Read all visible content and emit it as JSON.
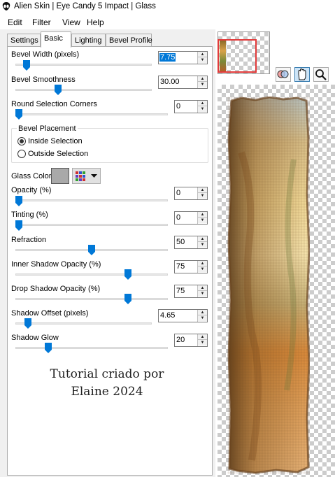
{
  "window": {
    "title": "Alien Skin | Eye Candy 5 Impact | Glass",
    "icon": "alien-skin-icon"
  },
  "menu": [
    "Edit",
    "Filter",
    "View",
    "Help"
  ],
  "tabs": [
    "Settings",
    "Basic",
    "Lighting",
    "Bevel Profile"
  ],
  "active_tab": "Basic",
  "controls": {
    "bevel_width": {
      "label": "Bevel Width (pixels)",
      "value": "7.75",
      "fraction": 0.06
    },
    "bevel_smoothness": {
      "label": "Bevel Smoothness",
      "value": "30.00",
      "fraction": 0.3
    },
    "round_corners": {
      "label": "Round Selection Corners",
      "value": "0",
      "fraction": 0.0
    },
    "opacity": {
      "label": "Opacity (%)",
      "value": "0",
      "fraction": 0.0
    },
    "tinting": {
      "label": "Tinting (%)",
      "value": "0",
      "fraction": 0.0
    },
    "refraction": {
      "label": "Refraction",
      "value": "50",
      "fraction": 0.5
    },
    "inner_shadow": {
      "label": "Inner Shadow Opacity (%)",
      "value": "75",
      "fraction": 0.75
    },
    "drop_shadow": {
      "label": "Drop Shadow Opacity (%)",
      "value": "75",
      "fraction": 0.75
    },
    "shadow_offset": {
      "label": "Shadow Offset (pixels)",
      "value": "4.65",
      "fraction": 0.07
    },
    "shadow_glow": {
      "label": "Shadow Glow",
      "value": "20",
      "fraction": 0.2
    }
  },
  "bevel_placement": {
    "title": "Bevel Placement",
    "options": [
      "Inside Selection",
      "Outside Selection"
    ],
    "selected": "Inside Selection"
  },
  "glass_color": {
    "label": "Glass Color",
    "color": "#a9a9a9"
  },
  "credit": {
    "line1": "Tutorial criado por",
    "line2": "Elaine 2024"
  },
  "tools": [
    "zoom-compare-icon",
    "hand-pan-icon",
    "magnifier-icon"
  ],
  "colors": {
    "accent": "#0078d7",
    "nav_frame": "#e23b3b"
  }
}
